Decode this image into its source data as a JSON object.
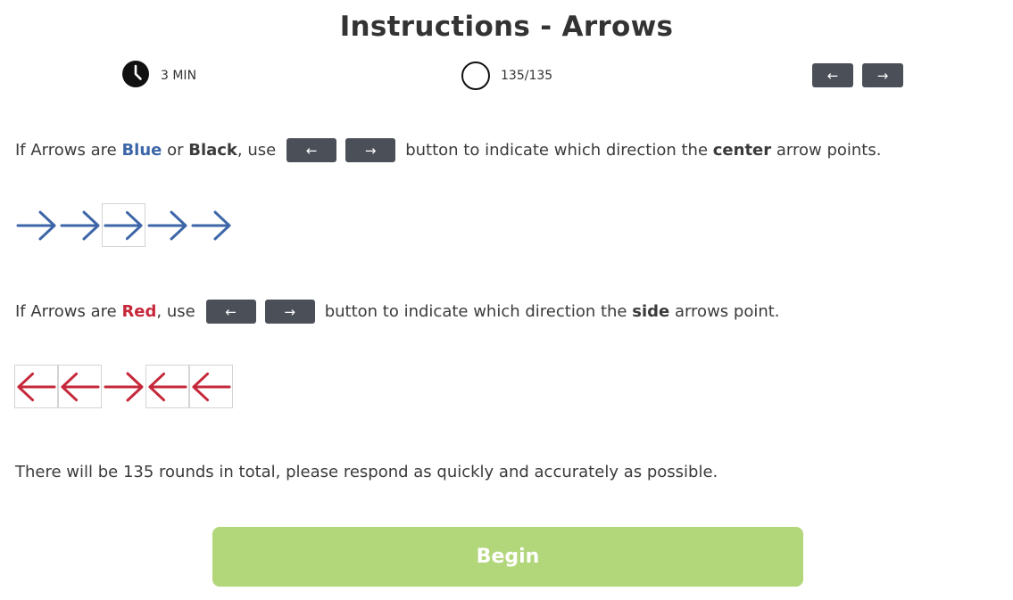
{
  "header": {
    "title": "Instructions - Arrows"
  },
  "stats": {
    "time": "3 MIN",
    "progress": "135/135"
  },
  "nav": {
    "left_arrow": "←",
    "right_arrow": "→"
  },
  "rule_blue": {
    "part1": "If Arrows are ",
    "blue": "Blue",
    "or": " or ",
    "black": "Black",
    "use": ", use",
    "button_left": "←",
    "button_right": "→",
    "part2": "button to indicate which direction the ",
    "emph": "center",
    "part3": " arrow points."
  },
  "example_blue": {
    "color": "#3d66a8",
    "directions": [
      "right",
      "right",
      "right",
      "right",
      "right"
    ],
    "framed": [
      false,
      false,
      true,
      false,
      false
    ]
  },
  "rule_red": {
    "part1": "If Arrows are ",
    "red": "Red",
    "use": ", use",
    "button_left": "←",
    "button_right": "→",
    "part2": "button to indicate which direction the ",
    "emph": "side",
    "part3": " arrows point."
  },
  "example_red": {
    "color": "#c5283a",
    "directions": [
      "left",
      "left",
      "right",
      "left",
      "left"
    ],
    "framed": [
      true,
      true,
      false,
      true,
      true
    ]
  },
  "note": "There will be 135 rounds in total, please respond as quickly and accurately as possible.",
  "begin_label": "Begin"
}
